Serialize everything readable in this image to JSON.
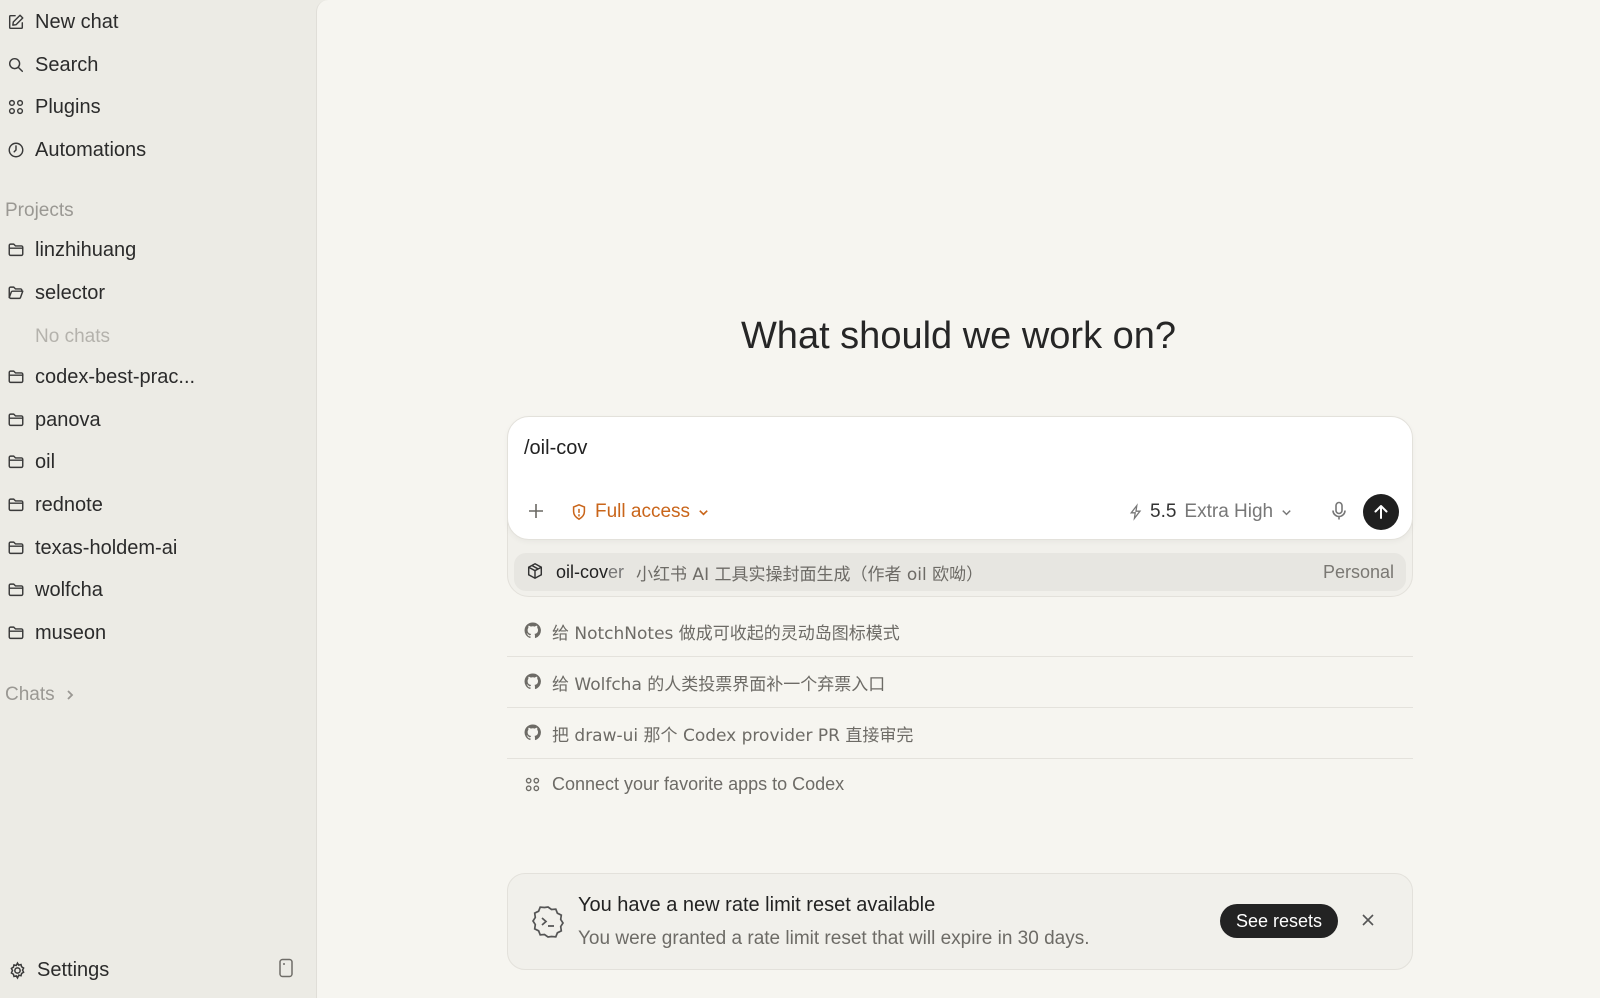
{
  "sidebar": {
    "nav": [
      {
        "label": "New chat",
        "icon": "compose-icon"
      },
      {
        "label": "Search",
        "icon": "search-icon"
      },
      {
        "label": "Plugins",
        "icon": "grid-icon"
      },
      {
        "label": "Automations",
        "icon": "clock-icon"
      }
    ],
    "projects_label": "Projects",
    "projects": [
      {
        "label": "linzhihuang",
        "icon": "folder-icon"
      },
      {
        "label": "selector",
        "icon": "folder-open-icon"
      },
      {
        "label": "codex-best-prac...",
        "icon": "folder-icon"
      },
      {
        "label": "panova",
        "icon": "folder-icon"
      },
      {
        "label": "oil",
        "icon": "folder-icon"
      },
      {
        "label": "rednote",
        "icon": "folder-icon"
      },
      {
        "label": "texas-holdem-ai",
        "icon": "folder-icon"
      },
      {
        "label": "wolfcha",
        "icon": "folder-icon"
      },
      {
        "label": "museon",
        "icon": "folder-icon"
      }
    ],
    "no_chats": "No chats",
    "chats_label": "Chats",
    "settings_label": "Settings"
  },
  "main": {
    "headline": "What should we work on?",
    "composer": {
      "value": "/oil-cov",
      "access_label": "Full access",
      "model_version": "5.5",
      "model_effort": "Extra High"
    },
    "suggestion": {
      "name_typed": "oil-cov",
      "name_rest": "er",
      "description": "小红书 AI 工具实操封面生成（作者 oil 欧呦）",
      "tag": "Personal"
    },
    "prompts": [
      {
        "text": "给 NotchNotes 做成可收起的灵动岛图标模式",
        "icon": "github-icon"
      },
      {
        "text": "给 Wolfcha 的人类投票界面补一个弃票入口",
        "icon": "github-icon"
      },
      {
        "text": "把 draw-ui 那个 Codex provider PR 直接审完",
        "icon": "github-icon"
      },
      {
        "text": "Connect your favorite apps to Codex",
        "icon": "grid-icon"
      }
    ],
    "banner": {
      "title": "You have a new rate limit reset available",
      "subtitle": "You were granted a rate limit reset that will expire in 30 days.",
      "button": "See resets"
    }
  },
  "colors": {
    "accent_warning": "#c9651a",
    "sidebar_bg": "#ecebe5",
    "main_bg": "#f6f5f0"
  }
}
